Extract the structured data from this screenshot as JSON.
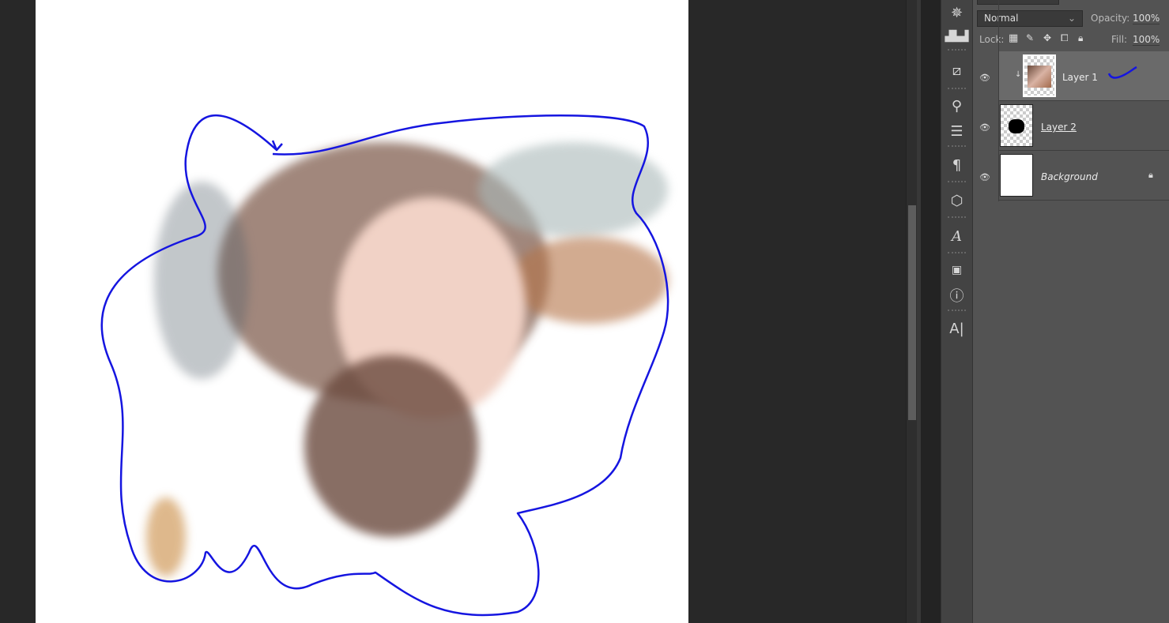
{
  "layers_panel": {
    "blend_mode": "Normal",
    "opacity_label": "Opacity:",
    "opacity": "100%",
    "lock_label": "Lock:",
    "fill_label": "Fill:",
    "fill": "100%",
    "layers": [
      {
        "name": "Layer 1",
        "visible": true,
        "selected": true,
        "clipped": true
      },
      {
        "name": "Layer 2",
        "visible": true
      },
      {
        "name": "Background",
        "visible": true,
        "locked": true
      }
    ]
  },
  "tools": [
    "navigator-icon",
    "histogram-icon",
    "clone-source-icon",
    "brush-presets-icon",
    "adjustments-icon",
    "paragraph-icon",
    "3d-icon",
    "glyphs-icon",
    "properties-icon",
    "info-icon",
    "character-icon"
  ],
  "colors": {
    "annotation": "#1515e0",
    "canvas_bg": "#282828",
    "panel_bg": "#535353"
  }
}
